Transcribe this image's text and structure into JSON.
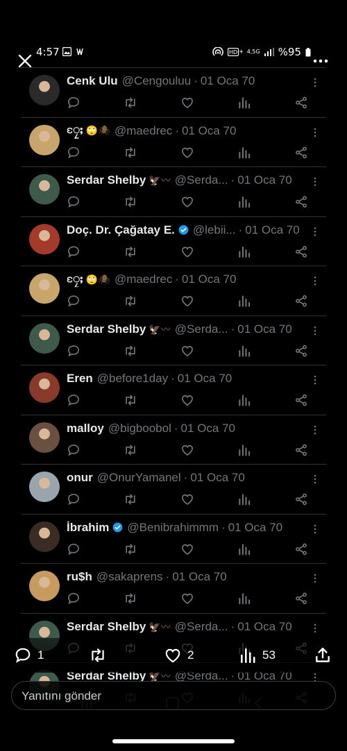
{
  "statusbar": {
    "time": "4:57",
    "battery": "%95",
    "network": "4,5G"
  },
  "posts": [
    {
      "name": "Cenk Ulu",
      "emoji": "",
      "verified": false,
      "handle": "@Cengouluu",
      "date": "01 Oca 70",
      "avatar": "#2a2a2a"
    },
    {
      "name": "ၠႄႈ",
      "emoji": "🙄🕷",
      "verified": false,
      "handle": "@maedrec",
      "date": "01 Oca 70",
      "avatar": "#c8a66b"
    },
    {
      "name": "Serdar Shelby",
      "emoji": "🦅〰",
      "verified": false,
      "handle": "@Serda...",
      "date": "01 Oca 70",
      "avatar": "#3d5a4a"
    },
    {
      "name": "Doç. Dr. Çağatay E.",
      "emoji": "",
      "verified": true,
      "handle": "@lebii...",
      "date": "01 Oca 70",
      "avatar": "#a33a2a"
    },
    {
      "name": "ၠႄႈ",
      "emoji": "🙄🕷",
      "verified": false,
      "handle": "@maedrec",
      "date": "01 Oca 70",
      "avatar": "#c8a66b"
    },
    {
      "name": "Serdar Shelby",
      "emoji": "🦅〰",
      "verified": false,
      "handle": "@Serda...",
      "date": "01 Oca 70",
      "avatar": "#3d5a4a"
    },
    {
      "name": "Eren",
      "emoji": "",
      "verified": false,
      "handle": "@before1day",
      "date": "01 Oca 70",
      "avatar": "#8a3a2a"
    },
    {
      "name": "malloy",
      "emoji": "",
      "verified": false,
      "handle": "@bigboobol",
      "date": "01 Oca 70",
      "avatar": "#6a5040"
    },
    {
      "name": "onur",
      "emoji": "",
      "verified": false,
      "handle": "@OnurYamanel",
      "date": "01 Oca 70",
      "avatar": "#9aa4ad"
    },
    {
      "name": "İbrahim",
      "emoji": "",
      "verified": true,
      "handle": "@Benibrahimmm",
      "date": "01 Oca 70",
      "avatar": "#3a2c24"
    },
    {
      "name": "ru$h",
      "emoji": "",
      "verified": false,
      "handle": "@sakaprens",
      "date": "01 Oca 70",
      "avatar": "#c79a60"
    },
    {
      "name": "Serdar Shelby",
      "emoji": "🦅〰",
      "verified": false,
      "handle": "@Serda...",
      "date": "01 Oca 70",
      "avatar": "#3d5a4a"
    },
    {
      "name": "Serdar Shelby",
      "emoji": "🦅〰",
      "verified": false,
      "handle": "@Serda...",
      "date": "01 Oca 70",
      "avatar": "#3d5a4a"
    }
  ],
  "bottombar": {
    "reply_count": "1",
    "like_count": "2",
    "view_count": "53"
  },
  "reply_input": {
    "placeholder": "Yanıtını gönder"
  },
  "colors": {
    "background": "#000000",
    "text": "#e7e9ea",
    "muted": "#71767b",
    "divider": "#2f3336",
    "verified": "#1d9bf0"
  }
}
